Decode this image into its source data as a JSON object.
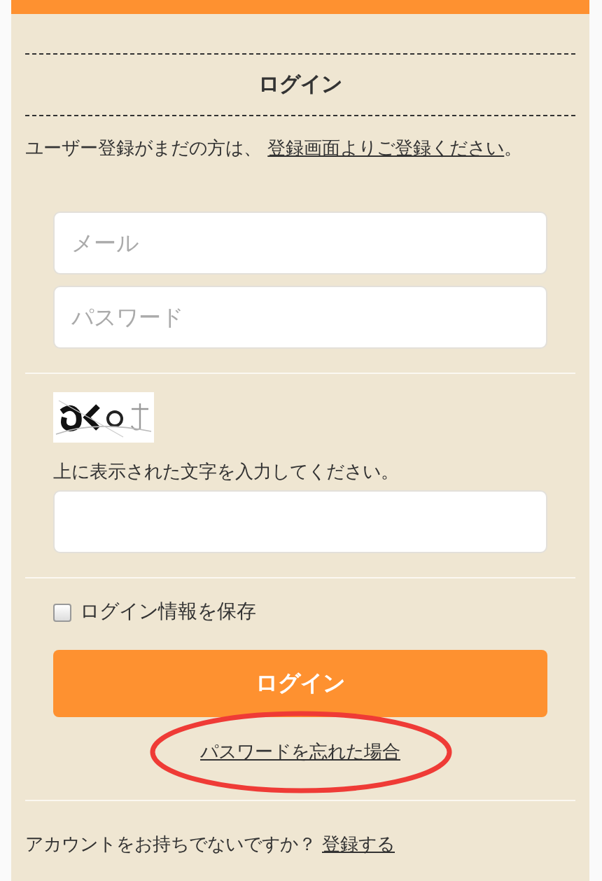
{
  "header": {
    "title": "ログイン"
  },
  "register_prompt": {
    "text": "ユーザー登録がまだの方は、",
    "link": "登録画面よりご登録ください",
    "suffix": "。"
  },
  "fields": [
    {
      "placeholder": "メール"
    },
    {
      "placeholder": "パスワード"
    }
  ],
  "captcha": {
    "kind": "picture",
    "prompt": "上に表示された文字を入力してください。"
  },
  "remember": {
    "label": "ログイン情報を保存",
    "checked": false
  },
  "submit": {
    "label": "ログイン"
  },
  "forgot": {
    "link": "パスワードを忘れた場合",
    "annotation": {
      "kind": "ellipse"
    }
  },
  "footer": {
    "text": "アカウントをお持ちでないですか？",
    "link": "登録する"
  }
}
